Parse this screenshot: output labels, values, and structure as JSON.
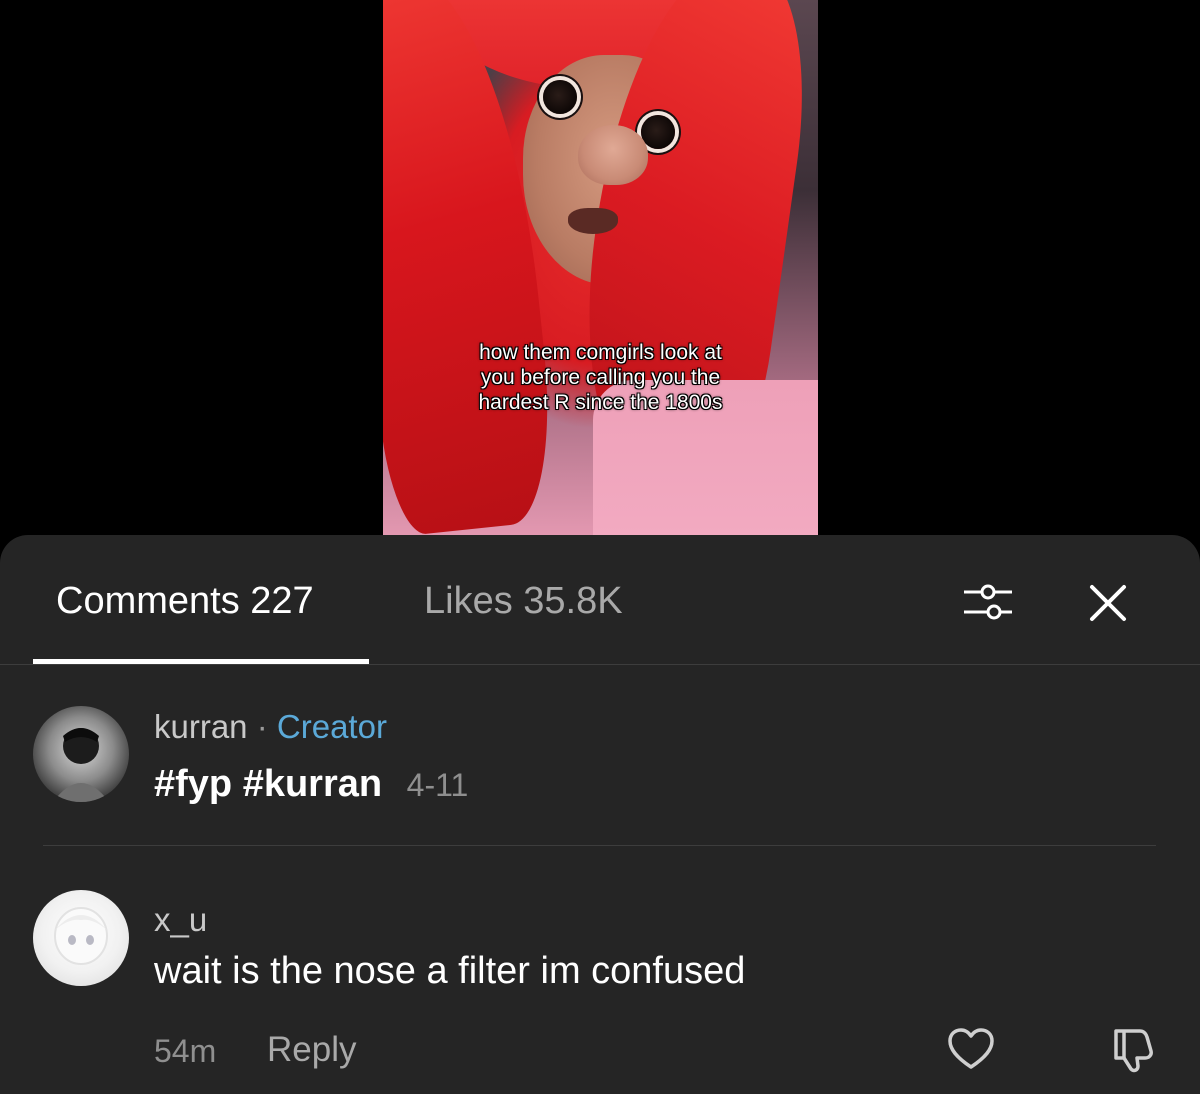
{
  "video": {
    "caption_lines": [
      "how them comgirls look at",
      "you before calling you the",
      "hardest R since the 1800s"
    ]
  },
  "tabs": {
    "comments_label": "Comments 227",
    "likes_label": "Likes 35.8K",
    "active": "comments"
  },
  "icons": {
    "filter": "sliders-icon",
    "close": "close-icon",
    "like": "heart-icon",
    "dislike": "thumbs-down-icon"
  },
  "comments": [
    {
      "username": "kurran",
      "separator": "·",
      "badge": "Creator",
      "tags": [
        "#fyp",
        "#kurran"
      ],
      "date": "4-11"
    },
    {
      "username": "x_u",
      "text": "wait is the nose a filter im confused",
      "time": "54m",
      "reply_label": "Reply"
    }
  ],
  "colors": {
    "sheet_bg": "#252525",
    "creator_badge": "#5ba9d8",
    "muted_text": "#8f8f8f",
    "hair_red": "#e0232a"
  }
}
